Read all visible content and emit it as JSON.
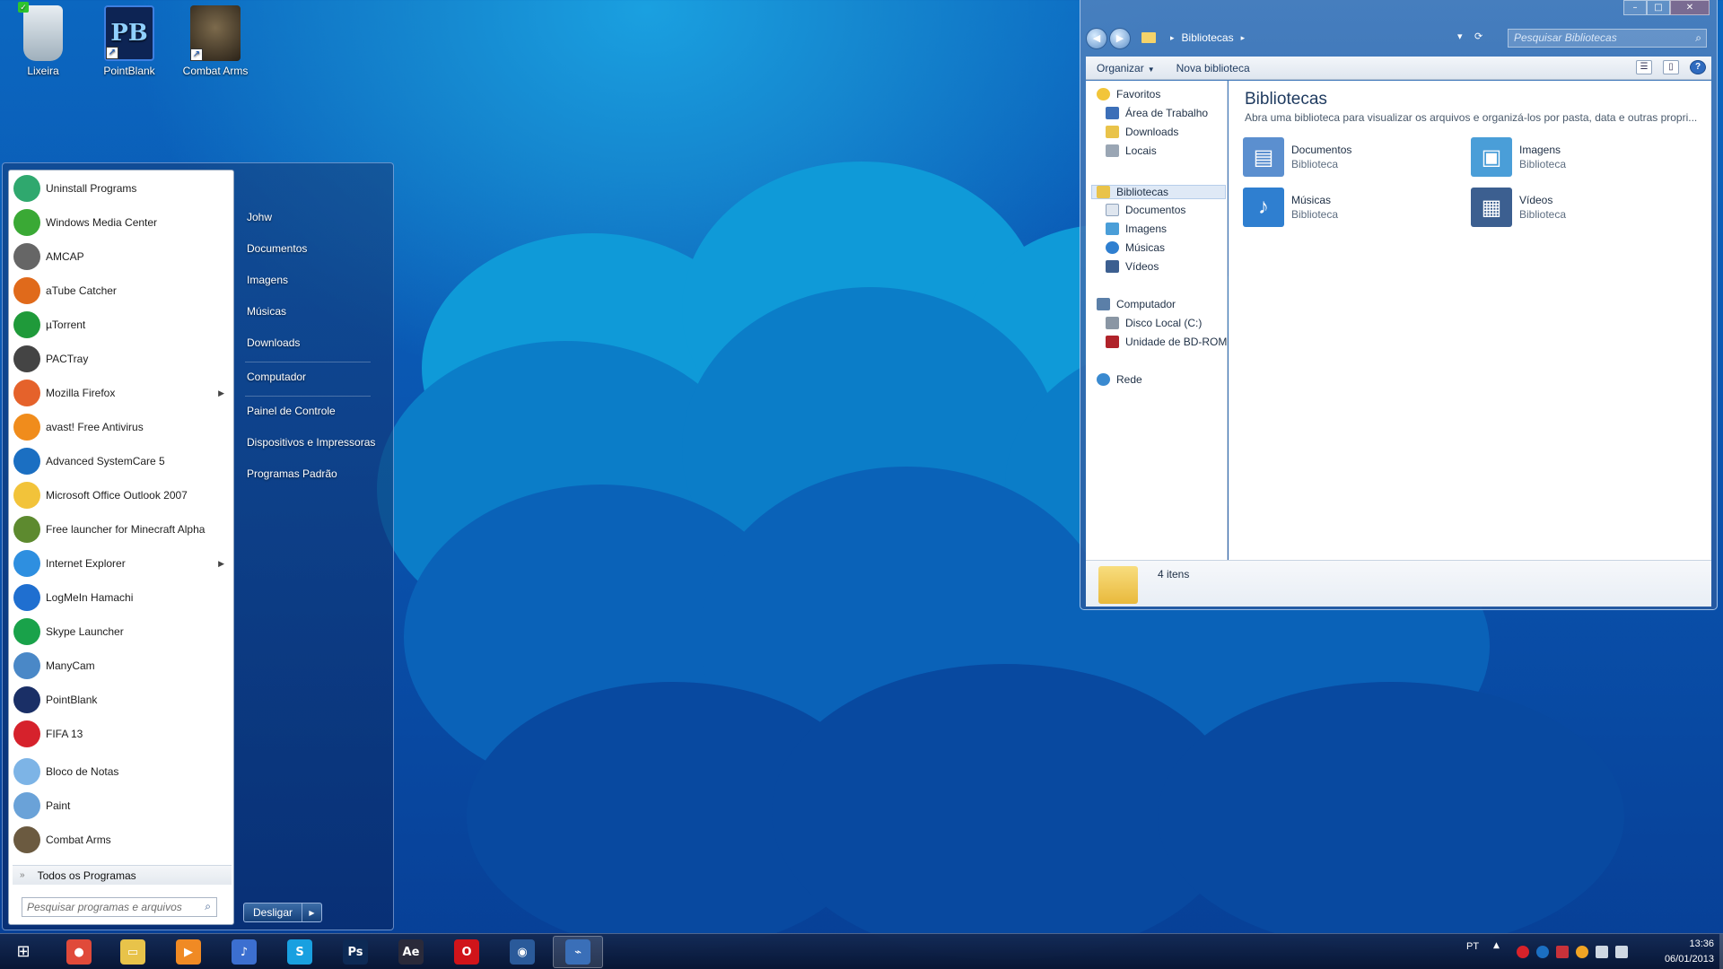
{
  "desktop": {
    "icons": [
      {
        "label": "Lixeira",
        "icon": "recycle-bin-icon"
      },
      {
        "label": "PointBlank",
        "icon": "pointblank-icon"
      },
      {
        "label": "Combat Arms",
        "icon": "combat-arms-icon"
      }
    ]
  },
  "start_menu": {
    "programs": [
      {
        "label": "Uninstall Programs",
        "icon": "uninstall-icon",
        "color": "#2fa86e"
      },
      {
        "label": "Windows Media Center",
        "icon": "media-center-icon",
        "color": "#3aa935"
      },
      {
        "label": "AMCAP",
        "icon": "amcap-icon",
        "color": "#666666"
      },
      {
        "label": "aTube Catcher",
        "icon": "atube-icon",
        "color": "#e06a1b"
      },
      {
        "label": "µTorrent",
        "icon": "utorrent-icon",
        "color": "#1f9a3a"
      },
      {
        "label": "PACTray",
        "icon": "pactray-icon",
        "color": "#444444"
      },
      {
        "label": "Mozilla Firefox",
        "icon": "firefox-icon",
        "color": "#e5622b",
        "submenu": true
      },
      {
        "label": "avast! Free Antivirus",
        "icon": "avast-icon",
        "color": "#f08c1c"
      },
      {
        "label": "Advanced SystemCare 5",
        "icon": "systemcare-icon",
        "color": "#1b6fc2"
      },
      {
        "label": "Microsoft Office Outlook 2007",
        "icon": "outlook-icon",
        "color": "#f2c33a"
      },
      {
        "label": "Free launcher for Minecraft Alpha",
        "icon": "minecraft-icon",
        "color": "#5d8a2f"
      },
      {
        "label": "Internet Explorer",
        "icon": "ie-icon",
        "color": "#2e8fe0",
        "submenu": true
      },
      {
        "label": "LogMeIn Hamachi",
        "icon": "hamachi-icon",
        "color": "#1f6fd0"
      },
      {
        "label": "Skype Launcher",
        "icon": "skype-icon",
        "color": "#19a24a"
      },
      {
        "label": "ManyCam",
        "icon": "manycam-icon",
        "color": "#4a88c7"
      },
      {
        "label": "PointBlank",
        "icon": "pointblank-icon",
        "color": "#1a2f66"
      },
      {
        "label": "FIFA 13",
        "icon": "fifa-icon",
        "color": "#d6222c"
      },
      {
        "label": "Bloco de Notas",
        "icon": "notepad-icon",
        "color": "#7db4e6"
      },
      {
        "label": "Paint",
        "icon": "paint-icon",
        "color": "#6aa2d8"
      },
      {
        "label": "Combat Arms",
        "icon": "combat-arms-icon",
        "color": "#6b5a40"
      }
    ],
    "all_programs": "Todos os Programas",
    "search_placeholder": "Pesquisar programas e arquivos",
    "places": [
      "Johw",
      "Documentos",
      "Imagens",
      "Músicas",
      "Downloads",
      "Computador",
      "Painel de Controle",
      "Dispositivos e Impressoras",
      "Programas Padrão"
    ],
    "shutdown": "Desligar"
  },
  "explorer": {
    "address": {
      "path": "Bibliotecas"
    },
    "search_placeholder": "Pesquisar Bibliotecas",
    "toolbar": {
      "organize": "Organizar",
      "new_library": "Nova biblioteca"
    },
    "nav": {
      "favorites": {
        "label": "Favoritos",
        "items": [
          "Área de Trabalho",
          "Downloads",
          "Locais"
        ]
      },
      "libraries": {
        "label": "Bibliotecas",
        "items": [
          "Documentos",
          "Imagens",
          "Músicas",
          "Vídeos"
        ]
      },
      "computer": {
        "label": "Computador",
        "items": [
          "Disco Local (C:)",
          "Unidade de BD-ROM"
        ]
      },
      "network": {
        "label": "Rede"
      }
    },
    "content": {
      "title": "Bibliotecas",
      "description": "Abra uma biblioteca para visualizar os arquivos e organizá-los por pasta, data e outras propri...",
      "libraries": [
        {
          "name": "Documentos",
          "type": "Biblioteca",
          "icon": "documents-library-icon",
          "color": "#5b8fcf"
        },
        {
          "name": "Imagens",
          "type": "Biblioteca",
          "icon": "pictures-library-icon",
          "color": "#4a9ed8"
        },
        {
          "name": "Músicas",
          "type": "Biblioteca",
          "icon": "music-library-icon",
          "color": "#2f7fd0"
        },
        {
          "name": "Vídeos",
          "type": "Biblioteca",
          "icon": "videos-library-icon",
          "color": "#3c5f90"
        }
      ]
    },
    "details": {
      "count": "4 itens"
    }
  },
  "taskbar": {
    "apps": [
      {
        "name": "chrome-icon",
        "color": "#e04a3a",
        "glyph": "●"
      },
      {
        "name": "explorer-icon",
        "color": "#e8c34a",
        "glyph": "▭"
      },
      {
        "name": "media-player-icon",
        "color": "#f08a24",
        "glyph": "▶"
      },
      {
        "name": "itunes-icon",
        "color": "#3c6fd0",
        "glyph": "♪"
      },
      {
        "name": "skype-icon",
        "color": "#19a0e0",
        "glyph": "S"
      },
      {
        "name": "photoshop-icon",
        "color": "#0d2a55",
        "glyph": "Ps"
      },
      {
        "name": "after-effects-icon",
        "color": "#2a2a3a",
        "glyph": "Ae"
      },
      {
        "name": "opera-icon",
        "color": "#d0141a",
        "glyph": "O"
      },
      {
        "name": "cinema4d-icon",
        "color": "#2a5a9a",
        "glyph": "◉"
      },
      {
        "name": "performance-icon",
        "color": "#3a6fb8",
        "glyph": "⌁"
      }
    ],
    "language": "PT",
    "time": "13:36",
    "date": "06/01/2013"
  }
}
